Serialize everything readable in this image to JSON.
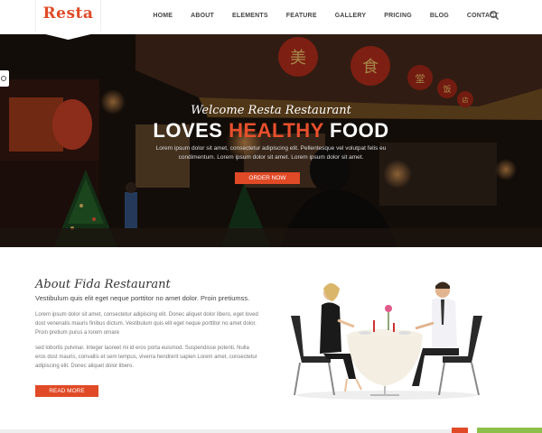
{
  "brand": {
    "logo": "Resta",
    "accent": "#e04a26"
  },
  "nav": {
    "items": [
      "HOME",
      "ABOUT",
      "ELEMENTS",
      "FEATURE",
      "GALLERY",
      "PRICING",
      "BLOG",
      "CONTACT"
    ],
    "search_icon": "search-icon"
  },
  "hero": {
    "welcome": "Welcome Resta Restaurant",
    "headline_pre": "LOVES ",
    "headline_highlight": "HEALTHY",
    "headline_post": " FOOD",
    "text": "Lorem ipsum dolor sit amet, consectetur adipiscing elit. Pellentesque vel volutpat felis eu condimentum. Lorem ipsum dolor sit amet. Lorem ipsum dolor sit amet.",
    "button": "ORDER NOW",
    "signs": [
      "美",
      "食",
      "堂",
      "饭",
      "店"
    ]
  },
  "about": {
    "title": "About Fida Restaurant",
    "subtitle": "Vestibulum quis elit eget neque porttitor no amet dolor. Proin pretiumss.",
    "para1": "Lorem ipsum dolor sit amet, consectetur adipiscing elit. Donec aliquet dolor libero, eget loved dost venenatis mauris finibus dictum. Vestibulum quis elit eget neque porttitor no amet dolor. Proin pretium purus a lorem ornare",
    "para2": "sed lobortis pulvinar. Integer laoreet mi id eros porta euismod. Suspendisse potenti. Nulla eros dost mauris, convallis et sem tempus, viverra hendrerit sapien Lorem amet, consectetur adipiscing elit. Donec aliquet dolor libero.",
    "button": "READ MORE"
  }
}
